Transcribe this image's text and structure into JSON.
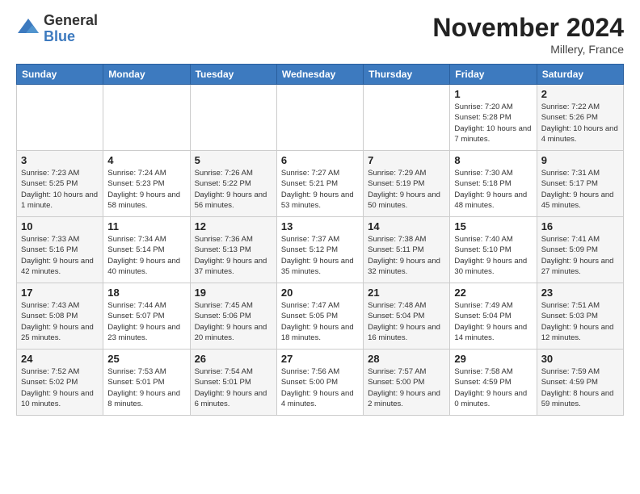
{
  "header": {
    "logo_line1": "General",
    "logo_line2": "Blue",
    "month": "November 2024",
    "location": "Millery, France"
  },
  "weekdays": [
    "Sunday",
    "Monday",
    "Tuesday",
    "Wednesday",
    "Thursday",
    "Friday",
    "Saturday"
  ],
  "weeks": [
    [
      {
        "day": "",
        "info": ""
      },
      {
        "day": "",
        "info": ""
      },
      {
        "day": "",
        "info": ""
      },
      {
        "day": "",
        "info": ""
      },
      {
        "day": "",
        "info": ""
      },
      {
        "day": "1",
        "info": "Sunrise: 7:20 AM\nSunset: 5:28 PM\nDaylight: 10 hours and 7 minutes."
      },
      {
        "day": "2",
        "info": "Sunrise: 7:22 AM\nSunset: 5:26 PM\nDaylight: 10 hours and 4 minutes."
      }
    ],
    [
      {
        "day": "3",
        "info": "Sunrise: 7:23 AM\nSunset: 5:25 PM\nDaylight: 10 hours and 1 minute."
      },
      {
        "day": "4",
        "info": "Sunrise: 7:24 AM\nSunset: 5:23 PM\nDaylight: 9 hours and 58 minutes."
      },
      {
        "day": "5",
        "info": "Sunrise: 7:26 AM\nSunset: 5:22 PM\nDaylight: 9 hours and 56 minutes."
      },
      {
        "day": "6",
        "info": "Sunrise: 7:27 AM\nSunset: 5:21 PM\nDaylight: 9 hours and 53 minutes."
      },
      {
        "day": "7",
        "info": "Sunrise: 7:29 AM\nSunset: 5:19 PM\nDaylight: 9 hours and 50 minutes."
      },
      {
        "day": "8",
        "info": "Sunrise: 7:30 AM\nSunset: 5:18 PM\nDaylight: 9 hours and 48 minutes."
      },
      {
        "day": "9",
        "info": "Sunrise: 7:31 AM\nSunset: 5:17 PM\nDaylight: 9 hours and 45 minutes."
      }
    ],
    [
      {
        "day": "10",
        "info": "Sunrise: 7:33 AM\nSunset: 5:16 PM\nDaylight: 9 hours and 42 minutes."
      },
      {
        "day": "11",
        "info": "Sunrise: 7:34 AM\nSunset: 5:14 PM\nDaylight: 9 hours and 40 minutes."
      },
      {
        "day": "12",
        "info": "Sunrise: 7:36 AM\nSunset: 5:13 PM\nDaylight: 9 hours and 37 minutes."
      },
      {
        "day": "13",
        "info": "Sunrise: 7:37 AM\nSunset: 5:12 PM\nDaylight: 9 hours and 35 minutes."
      },
      {
        "day": "14",
        "info": "Sunrise: 7:38 AM\nSunset: 5:11 PM\nDaylight: 9 hours and 32 minutes."
      },
      {
        "day": "15",
        "info": "Sunrise: 7:40 AM\nSunset: 5:10 PM\nDaylight: 9 hours and 30 minutes."
      },
      {
        "day": "16",
        "info": "Sunrise: 7:41 AM\nSunset: 5:09 PM\nDaylight: 9 hours and 27 minutes."
      }
    ],
    [
      {
        "day": "17",
        "info": "Sunrise: 7:43 AM\nSunset: 5:08 PM\nDaylight: 9 hours and 25 minutes."
      },
      {
        "day": "18",
        "info": "Sunrise: 7:44 AM\nSunset: 5:07 PM\nDaylight: 9 hours and 23 minutes."
      },
      {
        "day": "19",
        "info": "Sunrise: 7:45 AM\nSunset: 5:06 PM\nDaylight: 9 hours and 20 minutes."
      },
      {
        "day": "20",
        "info": "Sunrise: 7:47 AM\nSunset: 5:05 PM\nDaylight: 9 hours and 18 minutes."
      },
      {
        "day": "21",
        "info": "Sunrise: 7:48 AM\nSunset: 5:04 PM\nDaylight: 9 hours and 16 minutes."
      },
      {
        "day": "22",
        "info": "Sunrise: 7:49 AM\nSunset: 5:04 PM\nDaylight: 9 hours and 14 minutes."
      },
      {
        "day": "23",
        "info": "Sunrise: 7:51 AM\nSunset: 5:03 PM\nDaylight: 9 hours and 12 minutes."
      }
    ],
    [
      {
        "day": "24",
        "info": "Sunrise: 7:52 AM\nSunset: 5:02 PM\nDaylight: 9 hours and 10 minutes."
      },
      {
        "day": "25",
        "info": "Sunrise: 7:53 AM\nSunset: 5:01 PM\nDaylight: 9 hours and 8 minutes."
      },
      {
        "day": "26",
        "info": "Sunrise: 7:54 AM\nSunset: 5:01 PM\nDaylight: 9 hours and 6 minutes."
      },
      {
        "day": "27",
        "info": "Sunrise: 7:56 AM\nSunset: 5:00 PM\nDaylight: 9 hours and 4 minutes."
      },
      {
        "day": "28",
        "info": "Sunrise: 7:57 AM\nSunset: 5:00 PM\nDaylight: 9 hours and 2 minutes."
      },
      {
        "day": "29",
        "info": "Sunrise: 7:58 AM\nSunset: 4:59 PM\nDaylight: 9 hours and 0 minutes."
      },
      {
        "day": "30",
        "info": "Sunrise: 7:59 AM\nSunset: 4:59 PM\nDaylight: 8 hours and 59 minutes."
      }
    ]
  ]
}
